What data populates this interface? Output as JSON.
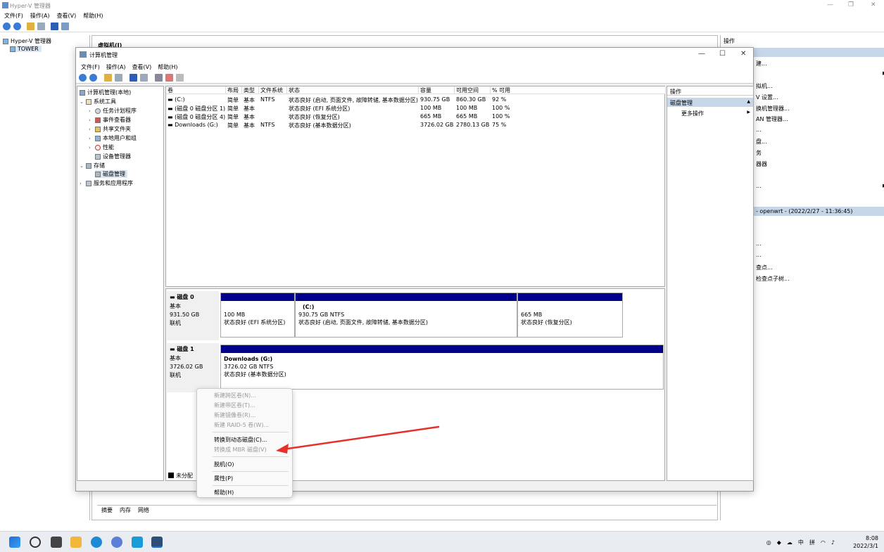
{
  "hyperv": {
    "title": "Hyper-V 管理器",
    "menu": [
      "文件(F)",
      "操作(A)",
      "查看(V)",
      "帮助(H)"
    ],
    "tree_root": "Hyper-V 管理器",
    "tree_child": "TOWER",
    "mid_header": "虚拟机(I)",
    "right_header": "操作",
    "right_items": [
      "建...",
      "拟机...",
      "V 设置...",
      "换机管理器...",
      "AN 管理器...",
      "盘...",
      "...",
      "务",
      "器器",
      "..."
    ],
    "right_vm": "- openwrt - (2022/2/27 - 11:36:45)",
    "right_items2": [
      "...",
      "...",
      "查点...",
      "检查点子树..."
    ],
    "bottom_tabs": [
      "摘要",
      "内存",
      "网络"
    ]
  },
  "cm": {
    "title": "计算机管理",
    "menu": [
      "文件(F)",
      "操作(A)",
      "查看(V)",
      "帮助(H)"
    ],
    "tree": {
      "root": "计算机管理(本地)",
      "system_tools": "系统工具",
      "task_scheduler": "任务计划程序",
      "event_viewer": "事件查看器",
      "shared_folders": "共享文件夹",
      "local_users": "本地用户和组",
      "performance": "性能",
      "device_manager": "设备管理器",
      "storage": "存储",
      "disk_management": "磁盘管理",
      "services_apps": "服务和应用程序"
    },
    "volume_headers": [
      "卷",
      "布局",
      "类型",
      "文件系统",
      "状态",
      "容量",
      "可用空间",
      "% 可用"
    ],
    "volumes": [
      [
        "(C:)",
        "简单",
        "基本",
        "NTFS",
        "状态良好 (启动, 页面文件, 故障转储, 基本数据分区)",
        "930.75 GB",
        "860.30 GB",
        "92 %"
      ],
      [
        "(磁盘 0 磁盘分区 1)",
        "简单",
        "基本",
        "",
        "状态良好 (EFI 系统分区)",
        "100 MB",
        "100 MB",
        "100 %"
      ],
      [
        "(磁盘 0 磁盘分区 4)",
        "简单",
        "基本",
        "",
        "状态良好 (恢复分区)",
        "665 MB",
        "665 MB",
        "100 %"
      ],
      [
        "Downloads (G:)",
        "简单",
        "基本",
        "NTFS",
        "状态良好 (基本数据分区)",
        "3726.02 GB",
        "2780.13 GB",
        "75 %"
      ]
    ],
    "disk0": {
      "name": "磁盘 0",
      "type": "基本",
      "size": "931.50 GB",
      "status": "联机",
      "p1_size": "100 MB",
      "p1_status": "状态良好 (EFI 系统分区)",
      "p2_name": "(C:)",
      "p2_size": "930.75 GB NTFS",
      "p2_status": "状态良好 (启动, 页面文件, 故障转储, 基本数据分区)",
      "p3_size": "665 MB",
      "p3_status": "状态良好 (恢复分区)"
    },
    "disk1": {
      "name": "磁盘 1",
      "type": "基本",
      "size": "3726.02 GB",
      "status": "联机",
      "p1_name": "Downloads  (G:)",
      "p1_size": "3726.02 GB NTFS",
      "p1_status": "状态良好 (基本数据分区)"
    },
    "legend": "未分配",
    "actions": {
      "header": "操作",
      "selected": "磁盘管理",
      "more": "更多操作"
    }
  },
  "context_menu": {
    "items": [
      {
        "label": "新建跨区卷(N)...",
        "disabled": true
      },
      {
        "label": "新建带区卷(T)...",
        "disabled": true
      },
      {
        "label": "新建镜像卷(R)...",
        "disabled": true
      },
      {
        "label": "新建 RAID-5 卷(W)...",
        "disabled": true
      },
      {
        "label": "转换到动态磁盘(C)...",
        "disabled": false
      },
      {
        "label": "转换成 MBR 磁盘(V)",
        "disabled": true
      },
      {
        "label": "脱机(O)",
        "disabled": false
      },
      {
        "label": "属性(P)",
        "disabled": false
      },
      {
        "label": "帮助(H)",
        "disabled": false
      }
    ]
  },
  "taskbar": {
    "ime": "中",
    "ime2": "拼",
    "time": "8:08",
    "date": "2022/3/1"
  },
  "colors": {
    "partition_bar": "#00008b",
    "selection": "#c6d7ea",
    "arrow": "#e8302a"
  }
}
